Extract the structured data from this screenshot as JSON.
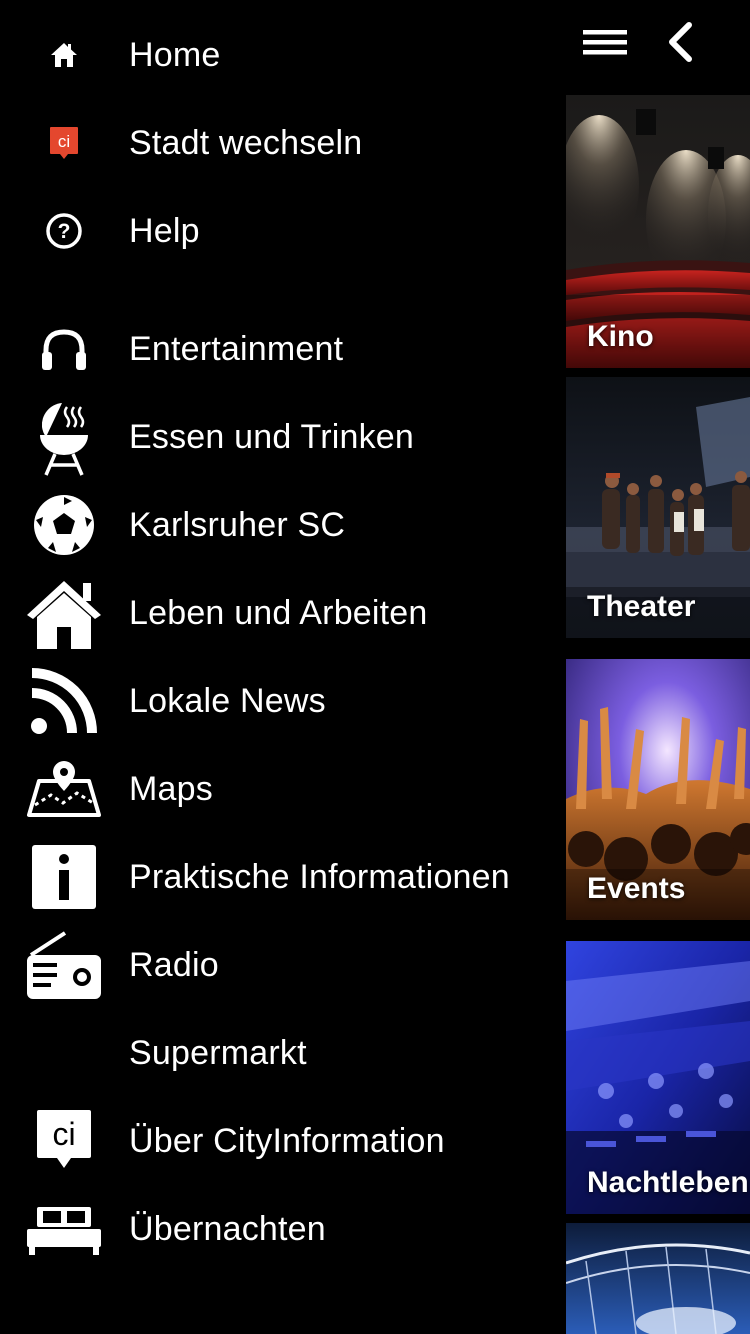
{
  "drawer": {
    "items": [
      {
        "label": "Home",
        "icon": "home-icon"
      },
      {
        "label": "Stadt wechseln",
        "icon": "ci-badge-red-icon"
      },
      {
        "label": "Help",
        "icon": "help-circle-icon"
      },
      {
        "label": "Entertainment",
        "icon": "headphones-icon"
      },
      {
        "label": "Essen und Trinken",
        "icon": "grill-icon"
      },
      {
        "label": "Karlsruher SC",
        "icon": "soccer-ball-icon"
      },
      {
        "label": "Leben und Arbeiten",
        "icon": "house-icon"
      },
      {
        "label": "Lokale News",
        "icon": "rss-icon"
      },
      {
        "label": "Maps",
        "icon": "map-pin-icon"
      },
      {
        "label": "Praktische Informationen",
        "icon": "info-icon"
      },
      {
        "label": "Radio",
        "icon": "radio-icon"
      },
      {
        "label": "Supermarkt",
        "icon": ""
      },
      {
        "label": "Über CityInformation",
        "icon": "ci-bubble-icon"
      },
      {
        "label": "Übernachten",
        "icon": "bed-icon"
      }
    ]
  },
  "topbar": {
    "menu_icon": "hamburger-icon",
    "back_icon": "chevron-left-icon"
  },
  "tiles": [
    {
      "label": "Kino"
    },
    {
      "label": "Theater"
    },
    {
      "label": "Events"
    },
    {
      "label": "Nachtleben"
    },
    {
      "label": ""
    }
  ],
  "colors": {
    "background": "#000000",
    "text": "#ffffff",
    "ci_red": "#e4472e"
  }
}
